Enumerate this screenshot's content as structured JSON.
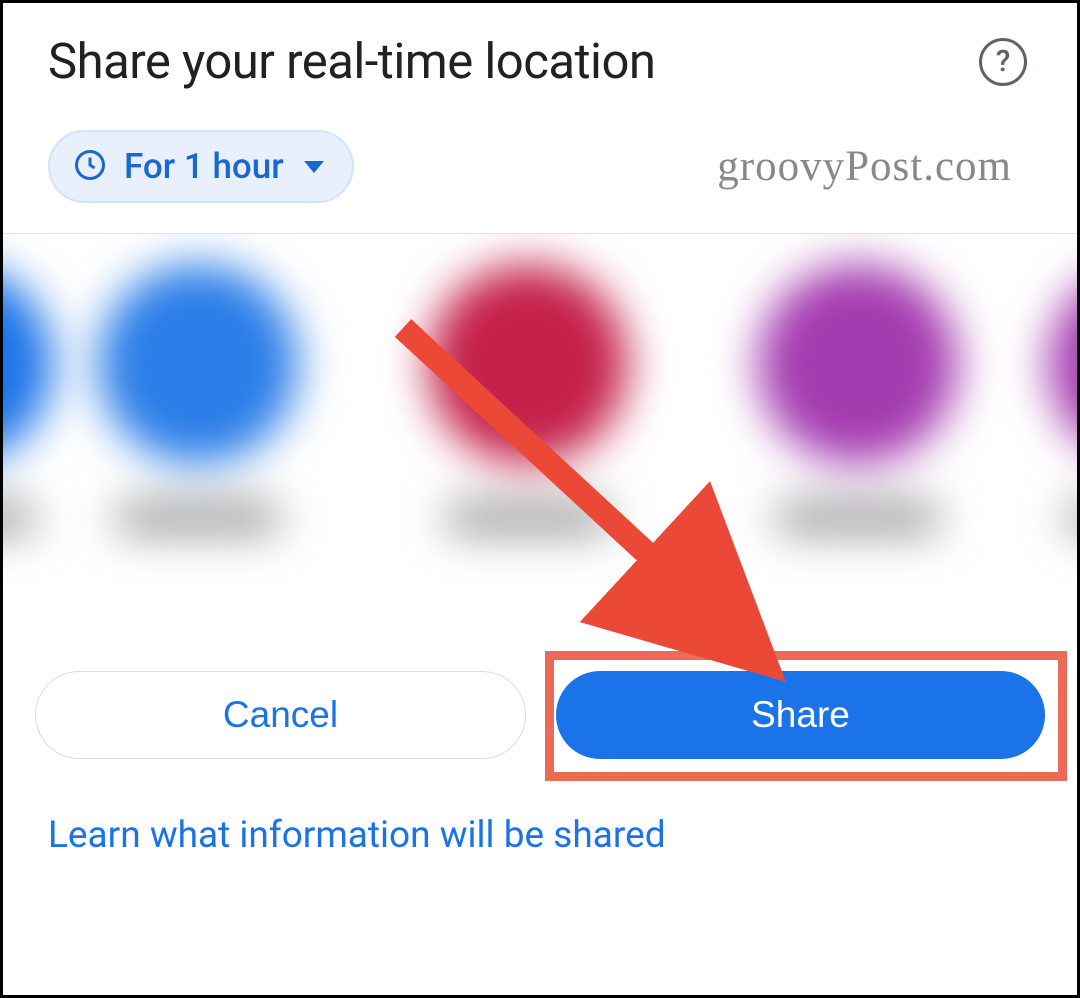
{
  "header": {
    "title": "Share your real-time location",
    "help_icon": "help-circle-icon"
  },
  "duration_chip": {
    "icon": "clock-icon",
    "label": "For 1 hour"
  },
  "watermark": "groovyPost.com",
  "contacts": {
    "avatars": [
      {
        "color": "blue"
      },
      {
        "color": "blue"
      },
      {
        "color": "red"
      },
      {
        "color": "purple"
      },
      {
        "color": "purple"
      }
    ]
  },
  "buttons": {
    "cancel": "Cancel",
    "share": "Share"
  },
  "annotation": {
    "highlight_target": "share-button",
    "arrow_color": "#ec4838"
  },
  "footer": {
    "link_text": "Learn what information will be shared"
  }
}
